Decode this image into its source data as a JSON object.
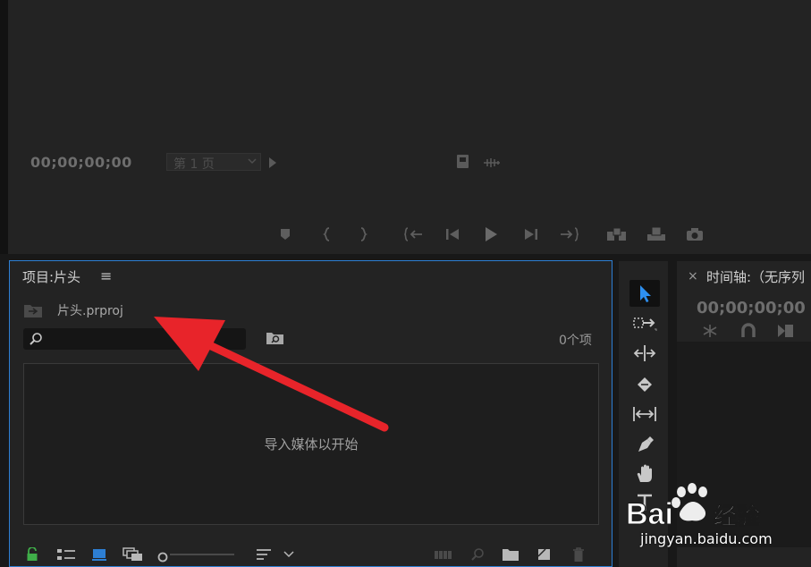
{
  "monitor": {
    "timecode": "00;00;00;00",
    "page_select": "第 1 页"
  },
  "project_panel": {
    "title": "项目:片头",
    "menu_icon": "≡",
    "project_file": "片头.prproj",
    "search_placeholder": "",
    "item_count": "0个项",
    "empty_message": "导入媒体以开始"
  },
  "timeline": {
    "close": "×",
    "title": "时间轴:（无序列",
    "timecode": "00;00;00;00"
  },
  "watermark": {
    "brand": "Baidu经验",
    "url": "jingyan.baidu.com"
  },
  "colors": {
    "accent": "#2d7fd4",
    "arrow": "#e8242a",
    "lock": "#3fae49"
  }
}
